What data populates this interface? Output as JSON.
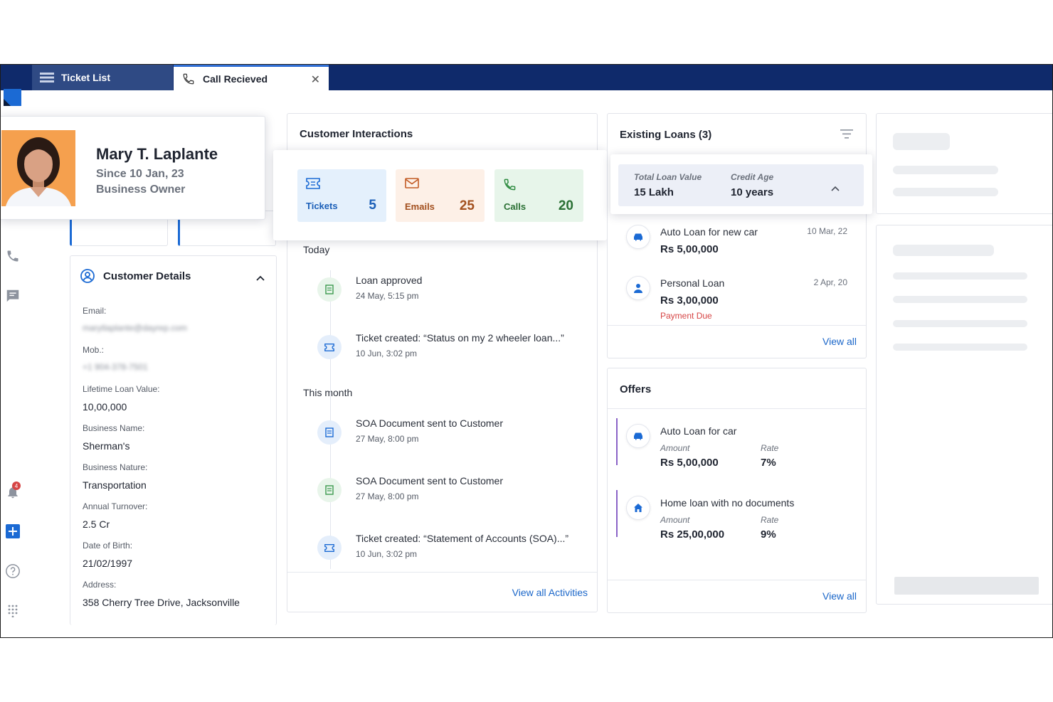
{
  "tabs": {
    "ticket_list": "Ticket List",
    "call_received": "Call Recieved",
    "close": "✕"
  },
  "rail": {
    "notification_count": "4"
  },
  "profile": {
    "name": "Mary T. Laplante",
    "since": "Since 10 Jan, 23",
    "role": "Business Owner"
  },
  "customer_details": {
    "title": "Customer Details",
    "fields": [
      {
        "label": "Email:",
        "value": "marytlaplante@dayrep.com",
        "blurred": true
      },
      {
        "label": "Mob.:",
        "value": "+1 904-378-7501",
        "blurred": true
      },
      {
        "label": "Lifetime Loan Value:",
        "value": "10,00,000"
      },
      {
        "label": "Business Name:",
        "value": "Sherman's"
      },
      {
        "label": "Business Nature:",
        "value": "Transportation"
      },
      {
        "label": "Annual Turnover:",
        "value": "2.5 Cr"
      },
      {
        "label": "Date of Birth:",
        "value": "21/02/1997"
      },
      {
        "label": "Address:",
        "value": "358 Cherry Tree Drive, Jacksonville"
      }
    ]
  },
  "interactions": {
    "title": "Customer Interactions",
    "stats": [
      {
        "label": "Tickets",
        "count": "5"
      },
      {
        "label": "Emails",
        "count": "25"
      },
      {
        "label": "Calls",
        "count": "20"
      }
    ],
    "groups": [
      {
        "heading": "Today",
        "items": [
          {
            "title": "Loan approved",
            "time": "24 May, 5:15 pm"
          },
          {
            "title": "Ticket created: “Status on my 2 wheeler loan...”",
            "time": "10 Jun, 3:02 pm"
          }
        ]
      },
      {
        "heading": "This month",
        "items": [
          {
            "title": "SOA Document sent to Customer",
            "time": "27 May, 8:00 pm"
          },
          {
            "title": "SOA Document sent to Customer",
            "time": "27 May, 8:00 pm"
          },
          {
            "title": "Ticket created: “Statement of Accounts (SOA)...”",
            "time": "10 Jun, 3:02 pm"
          }
        ]
      }
    ],
    "view_all": "View all Activities"
  },
  "loans": {
    "title": "Existing Loans (3)",
    "summary": {
      "total_label": "Total Loan Value",
      "total_value": "15 Lakh",
      "age_label": "Credit Age",
      "age_value": "10 years"
    },
    "items": [
      {
        "name": "Auto Loan for new car",
        "date": "10 Mar, 22",
        "amount": "Rs 5,00,000",
        "status": ""
      },
      {
        "name": "Personal Loan",
        "date": "2 Apr, 20",
        "amount": "Rs 3,00,000",
        "status": "Payment Due"
      }
    ],
    "view_all": "View all"
  },
  "offers": {
    "title": "Offers",
    "items": [
      {
        "name": "Auto Loan for car",
        "amount_label": "Amount",
        "amount": "Rs 5,00,000",
        "rate_label": "Rate",
        "rate": "7%"
      },
      {
        "name": "Home loan with no documents",
        "amount_label": "Amount",
        "amount": "Rs 25,00,000",
        "rate_label": "Rate",
        "rate": "9%"
      }
    ],
    "view_all": "View all"
  },
  "colors": {
    "navy": "#0f2a6b",
    "link": "#1a66c9",
    "tickets_bg": "#e4f0fc",
    "emails_bg": "#fdf0e7",
    "calls_bg": "#e7f5ea",
    "alert": "#d64545",
    "offer_accent": "#8a63c7"
  }
}
